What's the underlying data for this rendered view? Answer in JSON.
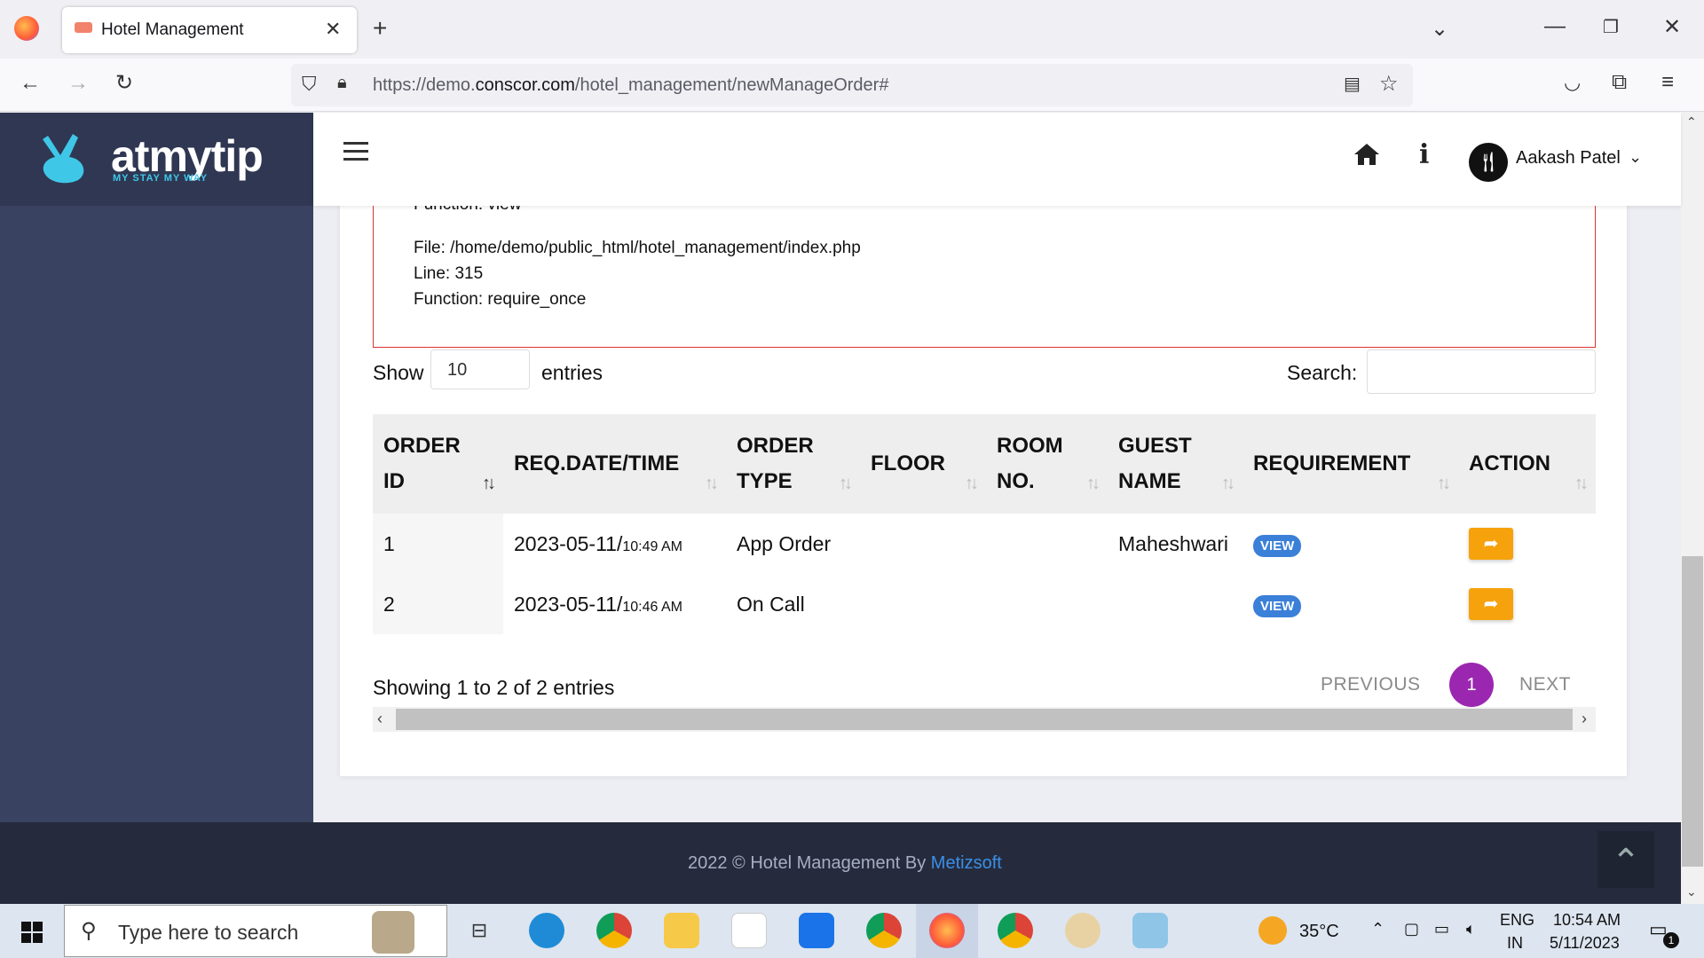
{
  "browser": {
    "tab_title": "Hotel Management",
    "url_prefix": "https://demo.",
    "url_domain": "conscor.com",
    "url_path": "/hotel_management/newManageOrder#"
  },
  "app": {
    "logo_text": "atmytip",
    "logo_tagline": "MY STAY MY WAY",
    "user_name": "Aakash Patel"
  },
  "error": {
    "line1": "Function: view",
    "line2": "File: /home/demo/public_html/hotel_management/index.php",
    "line3": "Line: 315",
    "line4": "Function: require_once"
  },
  "table_controls": {
    "show_label": "Show",
    "entries_value": "10",
    "entries_label": "entries",
    "search_label": "Search:"
  },
  "table": {
    "headers": [
      {
        "line1": "ORDER",
        "line2": "ID"
      },
      {
        "line1": "REQ.DATE/TIME",
        "line2": ""
      },
      {
        "line1": "ORDER",
        "line2": "TYPE"
      },
      {
        "line1": "FLOOR",
        "line2": ""
      },
      {
        "line1": "ROOM",
        "line2": "NO."
      },
      {
        "line1": "GUEST",
        "line2": "NAME"
      },
      {
        "line1": "REQUIREMENT",
        "line2": ""
      },
      {
        "line1": "ACTION",
        "line2": ""
      }
    ],
    "rows": [
      {
        "id": "1",
        "date": "2023-05-11/",
        "time": "10:49 AM",
        "type": "App Order",
        "floor": "",
        "room": "",
        "guest": "Maheshwari",
        "requirement": "VIEW"
      },
      {
        "id": "2",
        "date": "2023-05-11/",
        "time": "10:46 AM",
        "type": "On Call",
        "floor": "",
        "room": "",
        "guest": "",
        "requirement": "VIEW"
      }
    ]
  },
  "pagination": {
    "info": "Showing 1 to 2 of 2 entries",
    "previous": "PREVIOUS",
    "current": "1",
    "next": "NEXT"
  },
  "footer": {
    "text": "2022 © Hotel Management By ",
    "link": "Metizsoft"
  },
  "taskbar": {
    "search_placeholder": "Type here to search",
    "weather": "35°C",
    "lang1": "ENG",
    "lang2": "IN",
    "time": "10:54 AM",
    "date": "5/11/2023",
    "notif_count": "1"
  },
  "colors": {
    "sidebar": "#394260",
    "accent_purple": "#9b27b0",
    "action_orange": "#f6a20c",
    "view_blue": "#3b80d8",
    "error_border": "#dd3333"
  }
}
